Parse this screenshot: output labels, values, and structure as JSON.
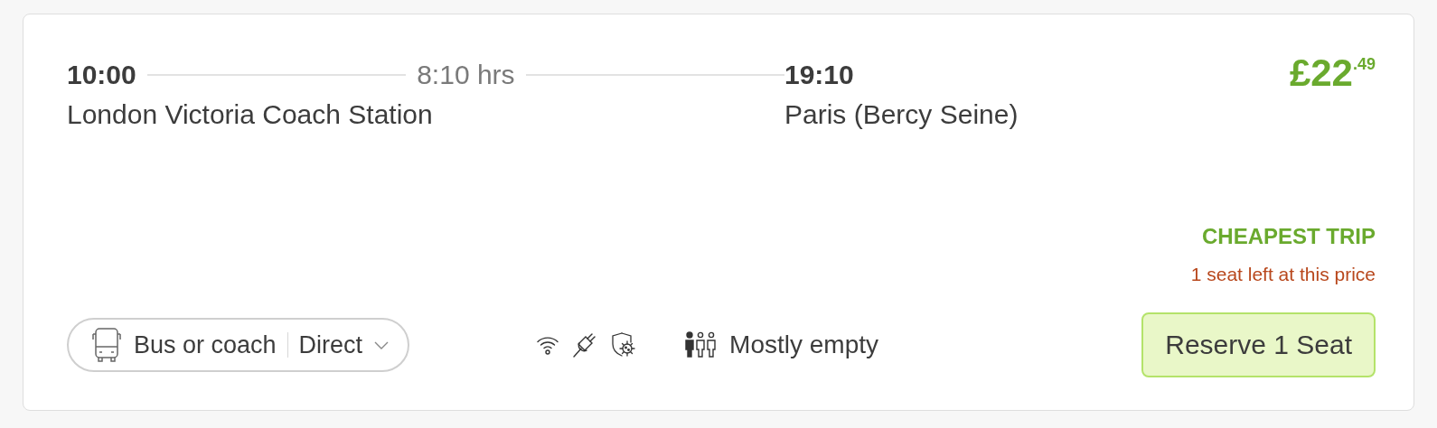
{
  "trip": {
    "departure": {
      "time": "10:00",
      "station": "London Victoria Coach Station"
    },
    "duration": "8:10 hrs",
    "arrival": {
      "time": "19:10",
      "station": "Paris (Bercy Seine)"
    },
    "price": "£22$^{.49}$",
    "badge": "CHEAPEST TRIP",
    "availability": "1 seat left at this price",
    "transport": {
      "mode": "Bus or coach",
      "connection": "Direct"
    },
    "amenities": [
      {
        "kind": "wifi"
      },
      {
        "kind": "power"
      },
      {
        "kind": "hygiene"
      }
    ],
    "occupancy": {
      "label": "Mostly empty"
    },
    "button": "Reserve 1 Seat"
  }
}
